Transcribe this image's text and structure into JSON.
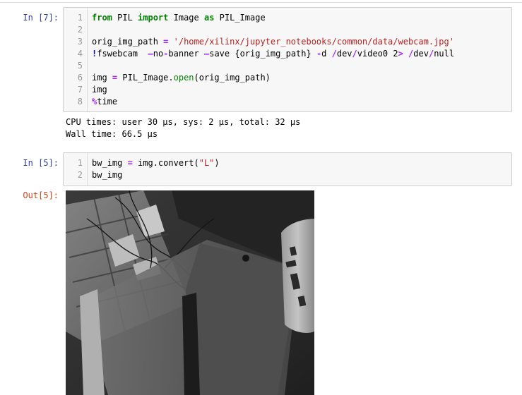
{
  "cells": [
    {
      "prompt": "In  [7]:",
      "lines": [
        {
          "n": "1",
          "segs": [
            {
              "t": "from",
              "c": "kw"
            },
            {
              "t": " PIL ",
              "c": ""
            },
            {
              "t": "import",
              "c": "kw"
            },
            {
              "t": " Image ",
              "c": ""
            },
            {
              "t": "as",
              "c": "kw"
            },
            {
              "t": " PIL_Image",
              "c": ""
            }
          ]
        },
        {
          "n": "2",
          "segs": []
        },
        {
          "n": "3",
          "segs": [
            {
              "t": "orig_img_path ",
              "c": ""
            },
            {
              "t": "=",
              "c": "op"
            },
            {
              "t": " ",
              "c": ""
            },
            {
              "t": "'/home/xilinx/jupyter_notebooks/common/data/webcam.jpg'",
              "c": "str"
            }
          ]
        },
        {
          "n": "4",
          "segs": [
            {
              "t": "!",
              "c": "bang"
            },
            {
              "t": "fswebcam  ",
              "c": ""
            },
            {
              "t": "—",
              "c": "op"
            },
            {
              "t": "no",
              "c": ""
            },
            {
              "t": "-",
              "c": "op"
            },
            {
              "t": "banner ",
              "c": ""
            },
            {
              "t": "—",
              "c": "op"
            },
            {
              "t": "save {orig_img_path} ",
              "c": ""
            },
            {
              "t": "-",
              "c": "op"
            },
            {
              "t": "d ",
              "c": ""
            },
            {
              "t": "/",
              "c": "op"
            },
            {
              "t": "dev",
              "c": ""
            },
            {
              "t": "/",
              "c": "op"
            },
            {
              "t": "video0 2",
              "c": ""
            },
            {
              "t": ">",
              "c": "op"
            },
            {
              "t": " ",
              "c": ""
            },
            {
              "t": "/",
              "c": "op"
            },
            {
              "t": "dev",
              "c": ""
            },
            {
              "t": "/",
              "c": "op"
            },
            {
              "t": "null",
              "c": ""
            }
          ]
        },
        {
          "n": "5",
          "segs": []
        },
        {
          "n": "6",
          "segs": [
            {
              "t": "img ",
              "c": ""
            },
            {
              "t": "=",
              "c": "op"
            },
            {
              "t": " PIL_Image.",
              "c": ""
            },
            {
              "t": "open",
              "c": "fn"
            },
            {
              "t": "(orig_img_path)",
              "c": ""
            }
          ]
        },
        {
          "n": "7",
          "segs": [
            {
              "t": "img",
              "c": ""
            }
          ]
        },
        {
          "n": "8",
          "segs": [
            {
              "t": "%",
              "c": "op"
            },
            {
              "t": "time",
              "c": ""
            }
          ]
        }
      ],
      "stream": [
        "CPU times: user 30 µs, sys: 2 µs, total: 32 µs",
        "Wall time: 66.5 µs"
      ]
    },
    {
      "prompt": "In  [5]:",
      "out_prompt": "Out[5]:",
      "lines": [
        {
          "n": "1",
          "segs": [
            {
              "t": "bw_img ",
              "c": ""
            },
            {
              "t": "=",
              "c": "op"
            },
            {
              "t": " img.convert(",
              "c": ""
            },
            {
              "t": "\"L\"",
              "c": "str"
            },
            {
              "t": ")",
              "c": ""
            }
          ]
        },
        {
          "n": "2",
          "segs": [
            {
              "t": "bw_img",
              "c": ""
            }
          ]
        }
      ]
    }
  ]
}
